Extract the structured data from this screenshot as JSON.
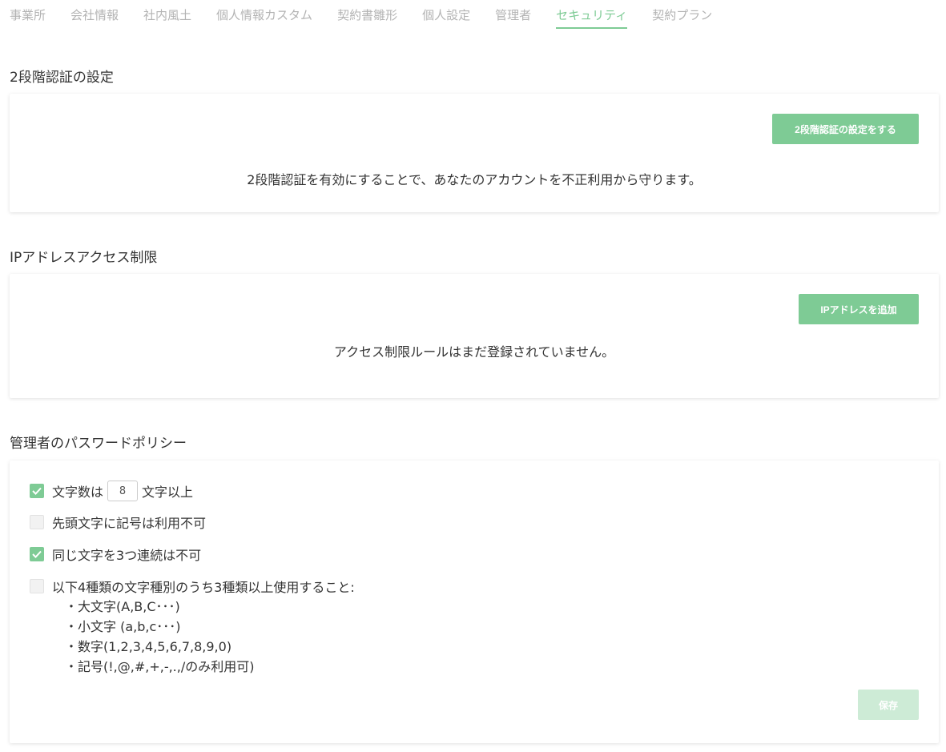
{
  "tabs": [
    {
      "label": "事業所",
      "active": false
    },
    {
      "label": "会社情報",
      "active": false
    },
    {
      "label": "社内風土",
      "active": false
    },
    {
      "label": "個人情報カスタム",
      "active": false
    },
    {
      "label": "契約書雛形",
      "active": false
    },
    {
      "label": "個人設定",
      "active": false
    },
    {
      "label": "管理者",
      "active": false
    },
    {
      "label": "セキュリティ",
      "active": true
    },
    {
      "label": "契約プラン",
      "active": false
    }
  ],
  "two_factor": {
    "title": "2段階認証の設定",
    "button_label": "2段階認証の設定をする",
    "message": "2段階認証を有効にすることで、あなたのアカウントを不正利用から守ります。"
  },
  "ip_restriction": {
    "title": "IPアドレスアクセス制限",
    "button_label": "IPアドレスを追加",
    "message": "アクセス制限ルールはまだ登録されていません。"
  },
  "password_policy": {
    "title": "管理者のパスワードポリシー",
    "min_length": {
      "checked": true,
      "prefix": "文字数は",
      "value": "8",
      "suffix": "文字以上"
    },
    "no_leading_symbol": {
      "checked": false,
      "label": "先頭文字に記号は利用不可"
    },
    "no_triple_repeat": {
      "checked": true,
      "label": "同じ文字を3つ連続は不可"
    },
    "char_types": {
      "checked": false,
      "label": "以下4種類の文字種別のうち3種類以上使用すること:",
      "items": [
        "・大文字(A,B,C･･･)",
        "・小文字 (a,b,c･･･)",
        "・数字(1,2,3,4,5,6,7,8,9,0)",
        "・記号(!,@,#,+,-,.,/のみ利用可)"
      ]
    },
    "save_label": "保存"
  },
  "colors": {
    "accent": "#7ecb95",
    "accent_disabled": "#cdebd6",
    "tab_inactive": "#b3b3b3"
  }
}
